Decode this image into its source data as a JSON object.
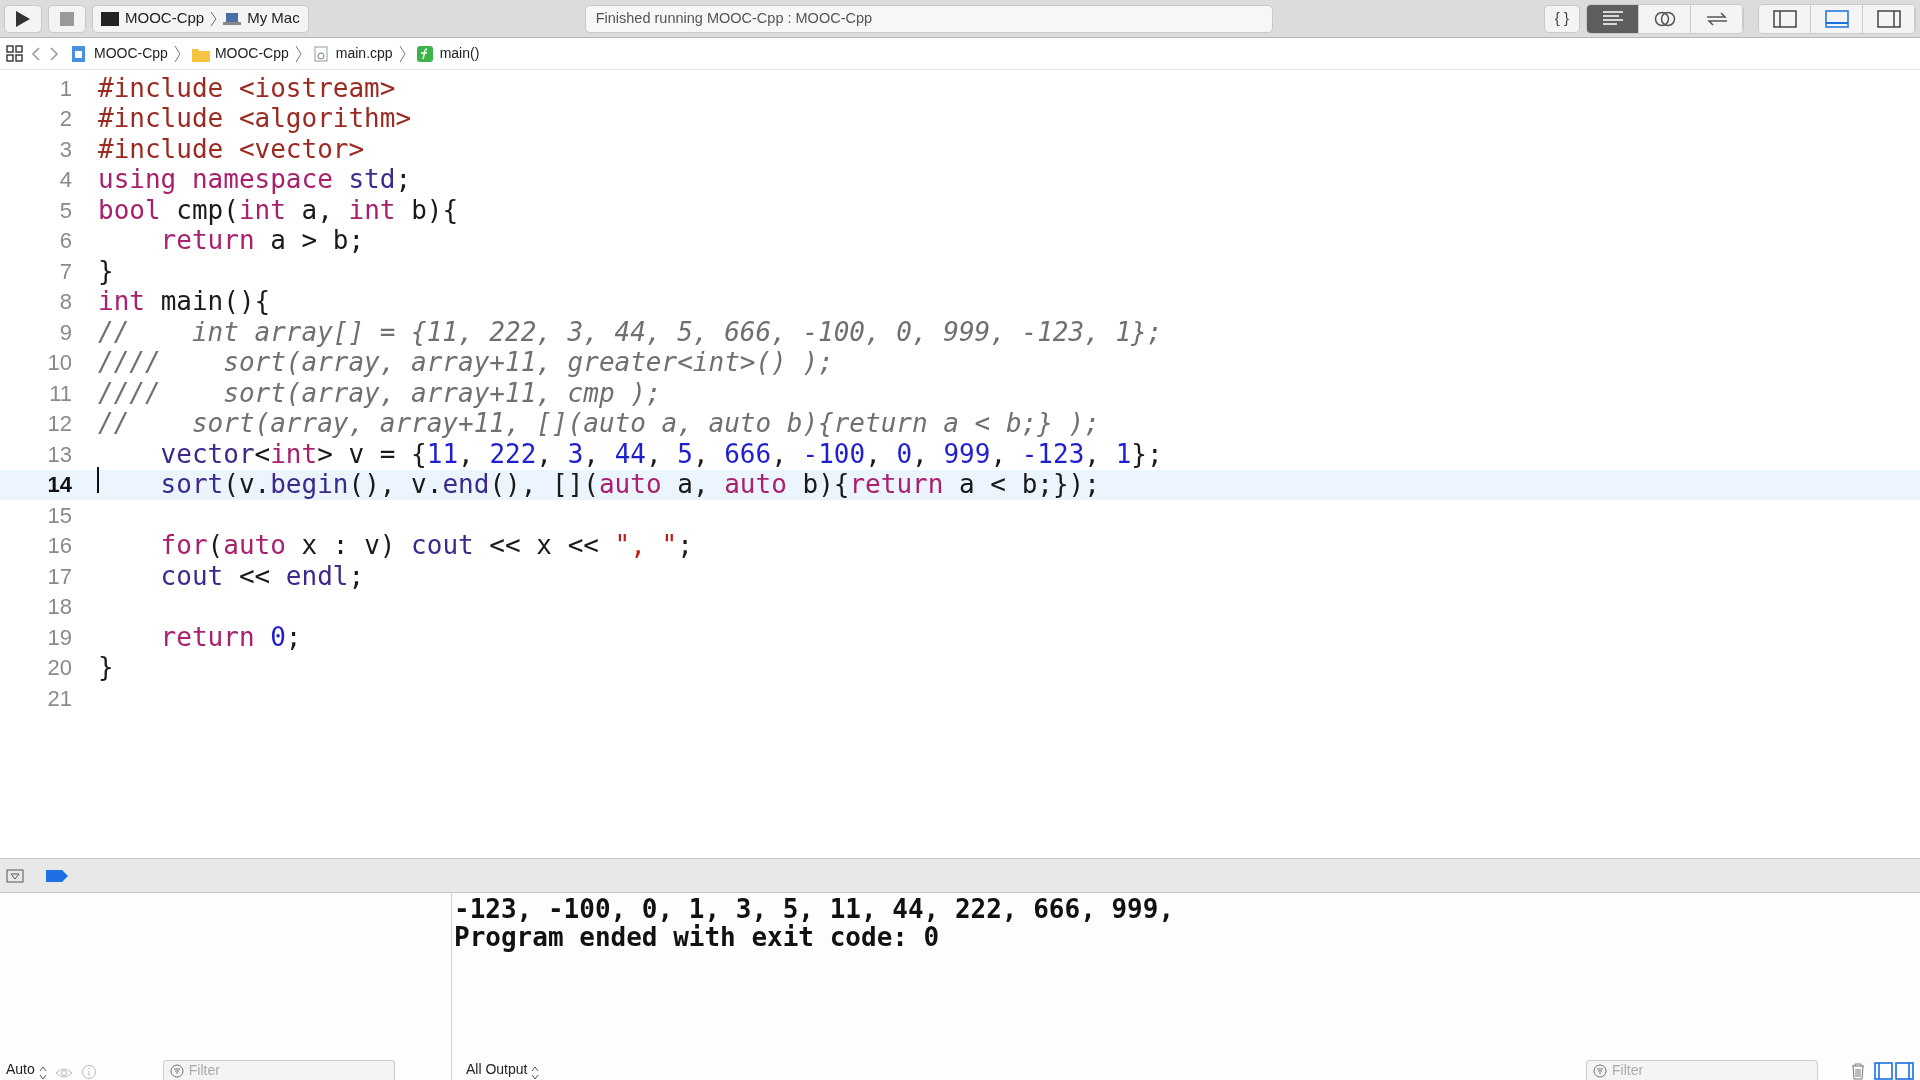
{
  "toolbar": {
    "scheme": "MOOC-Cpp",
    "destination": "My Mac",
    "status": "Finished running MOOC-Cpp : MOOC-Cpp",
    "library_button": "{ }",
    "editor_modes": [
      {
        "kind": "standard",
        "selected": true
      },
      {
        "kind": "assistant",
        "selected": false
      },
      {
        "kind": "version",
        "selected": false
      }
    ],
    "panels": [
      {
        "kind": "left",
        "selected": false
      },
      {
        "kind": "bottom",
        "selected": true
      },
      {
        "kind": "right",
        "selected": false
      }
    ]
  },
  "breadcrumb": [
    {
      "kind": "project",
      "label": "MOOC-Cpp"
    },
    {
      "kind": "folder",
      "label": "MOOC-Cpp"
    },
    {
      "kind": "file",
      "label": "main.cpp"
    },
    {
      "kind": "function",
      "label": "main()"
    }
  ],
  "code_lines": [
    {
      "number": "1",
      "current": false,
      "tokens": [
        {
          "kind": "pp",
          "text": "#include <iostream>"
        }
      ]
    },
    {
      "number": "2",
      "current": false,
      "tokens": [
        {
          "kind": "pp",
          "text": "#include <algorithm>"
        }
      ]
    },
    {
      "number": "3",
      "current": false,
      "tokens": [
        {
          "kind": "pp",
          "text": "#include <vector>"
        }
      ]
    },
    {
      "number": "4",
      "current": false,
      "tokens": [
        {
          "kind": "kw",
          "text": "using namespace "
        },
        {
          "kind": "lib",
          "text": "std"
        },
        {
          "kind": "plain",
          "text": ";"
        }
      ]
    },
    {
      "number": "5",
      "current": false,
      "tokens": [
        {
          "kind": "kw",
          "text": "bool "
        },
        {
          "kind": "plain",
          "text": "cmp("
        },
        {
          "kind": "kw",
          "text": "int "
        },
        {
          "kind": "plain",
          "text": "a, "
        },
        {
          "kind": "kw",
          "text": "int "
        },
        {
          "kind": "plain",
          "text": "b){"
        }
      ]
    },
    {
      "number": "6",
      "current": false,
      "tokens": [
        {
          "kind": "kw",
          "text": "    return "
        },
        {
          "kind": "plain",
          "text": "a > b;"
        }
      ]
    },
    {
      "number": "7",
      "current": false,
      "tokens": [
        {
          "kind": "plain",
          "text": "}"
        }
      ]
    },
    {
      "number": "8",
      "current": false,
      "tokens": [
        {
          "kind": "kw",
          "text": "int "
        },
        {
          "kind": "plain",
          "text": "main(){"
        }
      ]
    },
    {
      "number": "9",
      "current": false,
      "tokens": [
        {
          "kind": "cmt",
          "text": "//    int array[] = {11, 222, 3, 44, 5, 666, -100, 0, 999, -123, 1};"
        }
      ]
    },
    {
      "number": "10",
      "current": false,
      "tokens": [
        {
          "kind": "cmt",
          "text": "////    sort(array, array+11, greater<int>() );"
        }
      ]
    },
    {
      "number": "11",
      "current": false,
      "tokens": [
        {
          "kind": "cmt",
          "text": "////    sort(array, array+11, cmp );"
        }
      ]
    },
    {
      "number": "12",
      "current": false,
      "tokens": [
        {
          "kind": "cmt",
          "text": "//    sort(array, array+11, [](auto a, auto b){return a < b;} );"
        }
      ]
    },
    {
      "number": "13",
      "current": false,
      "tokens": [
        {
          "kind": "lib",
          "text": "    vector"
        },
        {
          "kind": "plain",
          "text": "<"
        },
        {
          "kind": "kw",
          "text": "int"
        },
        {
          "kind": "plain",
          "text": "> v = {"
        },
        {
          "kind": "num",
          "text": "11"
        },
        {
          "kind": "plain",
          "text": ", "
        },
        {
          "kind": "num",
          "text": "222"
        },
        {
          "kind": "plain",
          "text": ", "
        },
        {
          "kind": "num",
          "text": "3"
        },
        {
          "kind": "plain",
          "text": ", "
        },
        {
          "kind": "num",
          "text": "44"
        },
        {
          "kind": "plain",
          "text": ", "
        },
        {
          "kind": "num",
          "text": "5"
        },
        {
          "kind": "plain",
          "text": ", "
        },
        {
          "kind": "num",
          "text": "666"
        },
        {
          "kind": "plain",
          "text": ", "
        },
        {
          "kind": "num",
          "text": "-100"
        },
        {
          "kind": "plain",
          "text": ", "
        },
        {
          "kind": "num",
          "text": "0"
        },
        {
          "kind": "plain",
          "text": ", "
        },
        {
          "kind": "num",
          "text": "999"
        },
        {
          "kind": "plain",
          "text": ", "
        },
        {
          "kind": "num",
          "text": "-123"
        },
        {
          "kind": "plain",
          "text": ", "
        },
        {
          "kind": "num",
          "text": "1"
        },
        {
          "kind": "plain",
          "text": "};"
        }
      ]
    },
    {
      "number": "14",
      "current": true,
      "tokens": [
        {
          "kind": "lib",
          "text": "    sort"
        },
        {
          "kind": "plain",
          "text": "(v."
        },
        {
          "kind": "lib",
          "text": "begin"
        },
        {
          "kind": "plain",
          "text": "(), v."
        },
        {
          "kind": "lib",
          "text": "end"
        },
        {
          "kind": "plain",
          "text": "(), []("
        },
        {
          "kind": "kw",
          "text": "auto "
        },
        {
          "kind": "plain",
          "text": "a, "
        },
        {
          "kind": "kw",
          "text": "auto "
        },
        {
          "kind": "plain",
          "text": "b){"
        },
        {
          "kind": "kw",
          "text": "return "
        },
        {
          "kind": "plain",
          "text": "a < b;});"
        }
      ]
    },
    {
      "number": "15",
      "current": false
    },
    {
      "number": "16",
      "current": false,
      "tokens": [
        {
          "kind": "kw",
          "text": "    for"
        },
        {
          "kind": "plain",
          "text": "("
        },
        {
          "kind": "kw",
          "text": "auto "
        },
        {
          "kind": "plain",
          "text": "x : v) "
        },
        {
          "kind": "lib",
          "text": "cout"
        },
        {
          "kind": "plain",
          "text": " << x << "
        },
        {
          "kind": "str",
          "text": "\", \""
        },
        {
          "kind": "plain",
          "text": ";"
        }
      ]
    },
    {
      "number": "17",
      "current": false,
      "tokens": [
        {
          "kind": "lib",
          "text": "    cout"
        },
        {
          "kind": "plain",
          "text": " << "
        },
        {
          "kind": "lib",
          "text": "endl"
        },
        {
          "kind": "plain",
          "text": ";"
        }
      ]
    },
    {
      "number": "18",
      "current": false
    },
    {
      "number": "19",
      "current": false,
      "tokens": [
        {
          "kind": "kw",
          "text": "    return "
        },
        {
          "kind": "num",
          "text": "0"
        },
        {
          "kind": "plain",
          "text": ";"
        }
      ]
    },
    {
      "number": "20",
      "current": false,
      "tokens": [
        {
          "kind": "plain",
          "text": "}"
        }
      ]
    },
    {
      "number": "21",
      "current": false
    }
  ],
  "console_output": [
    "-123, -100, 0, 1, 3, 5, 11, 44, 222, 666, 999,",
    "Program ended with exit code: 0"
  ],
  "variables_bar": {
    "mode": "Auto",
    "filter_placeholder": "Filter"
  },
  "console_bar": {
    "mode": "All Output",
    "filter_placeholder": "Filter"
  }
}
